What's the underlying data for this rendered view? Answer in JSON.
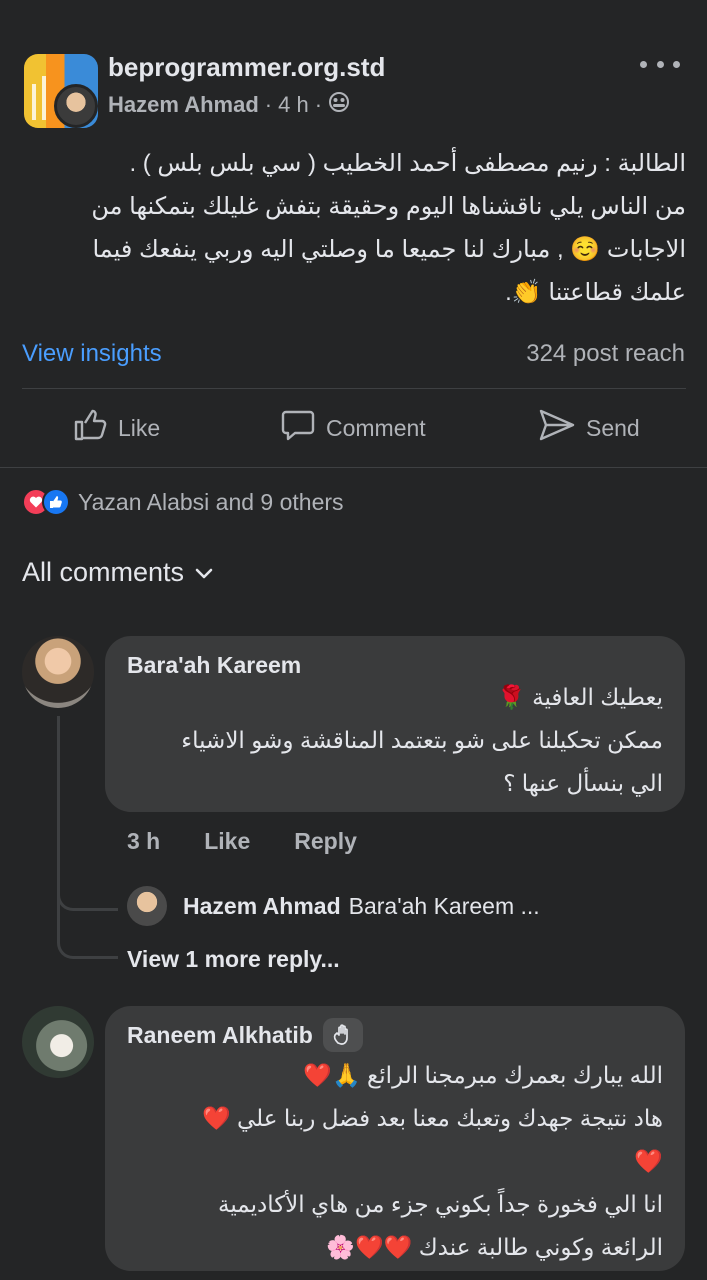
{
  "post": {
    "page_name": "beprogrammer.org.std",
    "author": "Hazem Ahmad",
    "time": "4 h",
    "body_lines": [
      "الطالبة : رنيم مصطفى أحمد الخطيب ( سي بلس بلس ) .",
      "من الناس يلي ناقشناها اليوم وحقيقة بتفش غليلك بتمكنها من",
      "الاجابات ☺️ , مبارك لنا جميعا ما وصلتي اليه وربي ينفعك فيما",
      "علمك قطاعتنا 👏."
    ],
    "view_insights": "View insights",
    "reach": "324 post reach"
  },
  "actions": {
    "like": "Like",
    "comment": "Comment",
    "send": "Send"
  },
  "reactions": {
    "summary": "Yazan Alabsi and 9 others"
  },
  "comments_filter": "All comments",
  "comments": [
    {
      "name": "Bara'ah Kareem",
      "lines": [
        "يعطيك العافية 🌹",
        "ممكن تحكيلنا على شو بتعتمد المناقشة وشو الاشياء",
        "الي بنسأل عنها ؟"
      ],
      "time": "3 h",
      "like": "Like",
      "reply": "Reply",
      "reply_preview": {
        "author": "Hazem Ahmad",
        "text": "Bara'ah Kareem ..."
      },
      "more_replies": "View 1 more reply..."
    },
    {
      "name": "Raneem Alkhatib",
      "lines": [
        "الله يبارك بعمرك مبرمجنا الرائع 🙏❤️",
        "هاد نتيجة جهدك وتعبك معنا بعد فضل ربنا علي ❤️",
        "❤️",
        "انا الي فخورة جداً بكوني جزء من هاي الأكاديمية",
        "الرائعة وكوني طالبة عندك ❤️❤️🌸"
      ]
    }
  ],
  "icons": {
    "privacy": "friends-icon",
    "more": "more-dots-icon",
    "badge": "wave-hand-badge-icon"
  },
  "colors": {
    "background": "#242526",
    "bubble": "#3a3b3c",
    "link": "#4a9eff",
    "text": "#e4e6eb",
    "muted": "#b0b3b8"
  }
}
